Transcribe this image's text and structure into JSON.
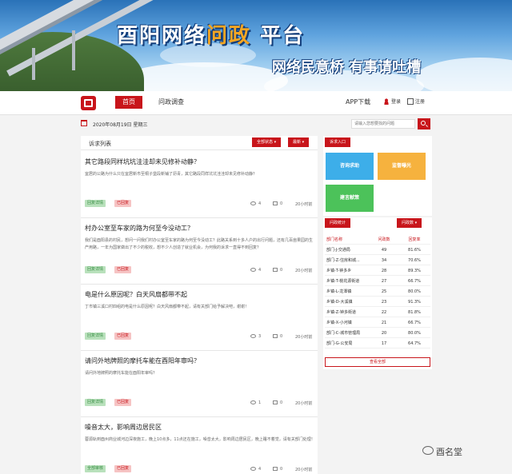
{
  "banner": {
    "title_pre": "酉阳网络",
    "title_highlight": "问政",
    "title_post": "平台",
    "slogan": "网络民意桥 有事请吐槽"
  },
  "nav": {
    "home": "首页",
    "inquiry": "问政调查",
    "app": "APP下载",
    "login": "登录",
    "register": "注册"
  },
  "date_text": "2020年08月19日 星期三",
  "search": {
    "placeholder": "请输入您想要找的问题"
  },
  "feed": {
    "title": "诉求列表",
    "filter_status": "全部状态 ▾",
    "filter_sort": "最新 ▾",
    "posts": [
      {
        "title": "其它路段同样坑坑洼洼却未见修补动静？",
        "excerpt": "宜居的公路为什么只在宜居新市至桐子堡段新铺了沥青，其它路段同样坑坑洼洼却未见修补动静？",
        "tag1": "回复详情",
        "tag2": "已回复",
        "views": "4",
        "comments": "0",
        "time": "20小时前"
      },
      {
        "title": "村办公室至车家的路为何至今没动工？",
        "excerpt": "我们是酉阳县的村民，想问一问我们村办公室至车家的路为何至今没动工？此路关系到十多人户的出行问题，还有几百亩果园的生产用路，一年为国家做出了不少的税收，想不少人创造了就业机会，为何我的诉求一直得不到回复？",
        "tag1": "回复详情",
        "tag2": "已回复",
        "views": "4",
        "comments": "0",
        "time": "20小时前"
      },
      {
        "title": "电是什么原因呢？白天风扇都带不起",
        "excerpt": "丁市镇三溪口村四组的电是什么原因呢？白天风扇都带不起，请有关部门给予解决吧，谢谢！",
        "tag1": "回复详情",
        "tag2": "已回复",
        "views": "3",
        "comments": "0",
        "time": "20小时前"
      },
      {
        "title": "请问外地牌照的摩托车能在酉阳年审吗？",
        "excerpt": "请问外地牌照的摩托车能在酉阳年审吗？",
        "tag1": "回复详情",
        "tag2": "已回复",
        "views": "1",
        "comments": "0",
        "time": "20小时前"
      },
      {
        "title": "噪音太大，影响周边居民区",
        "excerpt": "蓉源轨到酉州商业城河边深夜施工，晚上10点多，11点还在施工，噪音太大，影响周边居民区，晚上睡不着觉，请有关部门处理！",
        "tag1": "全部审核",
        "tag2": "已回复",
        "views": "4",
        "comments": "0",
        "time": "20小时前"
      }
    ]
  },
  "sidebar": {
    "entry_title": "诉求入口",
    "tiles": [
      {
        "label": "咨询求助",
        "color": "#3daee9"
      },
      {
        "label": "监督曝光",
        "color": "#f6b23e"
      },
      {
        "label": "建言献策",
        "color": "#4cc25a"
      }
    ],
    "stats_title": "问政统计",
    "stats_filter": "问政数 ▾",
    "stats_header": {
      "dept": "部门名称",
      "count": "问政数",
      "rate": "回复率"
    },
    "stats_rows": [
      {
        "dept": "部门-J-交通局",
        "count": "49",
        "rate": "81.6%"
      },
      {
        "dept": "部门-Z-住房和城...",
        "count": "34",
        "rate": "70.6%"
      },
      {
        "dept": "乡镇-T-钟多乡",
        "count": "28",
        "rate": "89.3%"
      },
      {
        "dept": "乡镇-T-桃花源街道",
        "count": "27",
        "rate": "66.7%"
      },
      {
        "dept": "乡镇-L-龙潭镇",
        "count": "25",
        "rate": "80.0%"
      },
      {
        "dept": "乡镇-D-大溪镇",
        "count": "23",
        "rate": "91.3%"
      },
      {
        "dept": "乡镇-Z-钟多街道",
        "count": "22",
        "rate": "81.8%"
      },
      {
        "dept": "乡镇-X-小河镇",
        "count": "21",
        "rate": "66.7%"
      },
      {
        "dept": "部门-C-城市管理局",
        "count": "20",
        "rate": "80.0%"
      },
      {
        "dept": "部门-G-公安局",
        "count": "17",
        "rate": "64.7%"
      }
    ],
    "view_all": "查看全部"
  },
  "watermark": "酉名堂",
  "colors": {
    "accent": "#c8151b"
  }
}
